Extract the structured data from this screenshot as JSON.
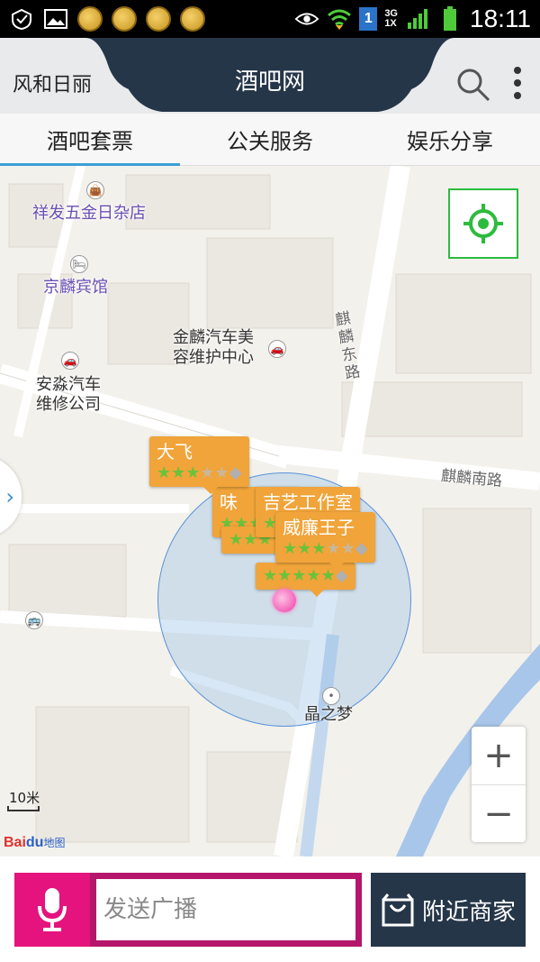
{
  "status_bar": {
    "time": "18:11",
    "network_top": "3G",
    "network_bottom": "1X",
    "sim": "1",
    "icons": [
      "check-shield-icon",
      "image-icon",
      "coin-icon",
      "coin-icon",
      "coin-icon",
      "coin-icon",
      "eye-icon",
      "wifi-icon",
      "signal-icon",
      "battery-icon"
    ]
  },
  "header": {
    "username": "风和日丽",
    "title": "酒吧网",
    "bg_color": "#263649"
  },
  "tabs": [
    {
      "label": "酒吧套票",
      "active": true
    },
    {
      "label": "公关服务",
      "active": false
    },
    {
      "label": "娱乐分享",
      "active": false
    }
  ],
  "map": {
    "pois": [
      {
        "label": "祥发五金日杂店"
      },
      {
        "label": "京麟宾馆"
      },
      {
        "label": "金麟汽车美\n容维护中心"
      },
      {
        "label": "安淼汽车\n维修公司"
      },
      {
        "label": "晶之梦"
      }
    ],
    "roads": [
      {
        "label": "麒\n麟\n东\n路"
      },
      {
        "label": "麒麟南路"
      }
    ],
    "markers": [
      {
        "name": "大飞",
        "stars": 3
      },
      {
        "name": "吉艺工作室",
        "stars": 4
      },
      {
        "name": "威廉王子",
        "stars": 3
      },
      {
        "name": "味",
        "stars": 3
      },
      {
        "name": "",
        "stars": 5
      }
    ],
    "scale": "10米",
    "logo": {
      "bai": "Bai",
      "du": "du",
      "suffix": "地图"
    },
    "zoom_in": "+",
    "zoom_out": "−"
  },
  "bottom": {
    "input_placeholder": "发送广播",
    "nearby_label": "附近商家"
  },
  "colors": {
    "accent_tab": "#3a9fd6",
    "marker": "#f0a43a",
    "mic": "#e4137d",
    "locate": "#2dbb3e"
  }
}
